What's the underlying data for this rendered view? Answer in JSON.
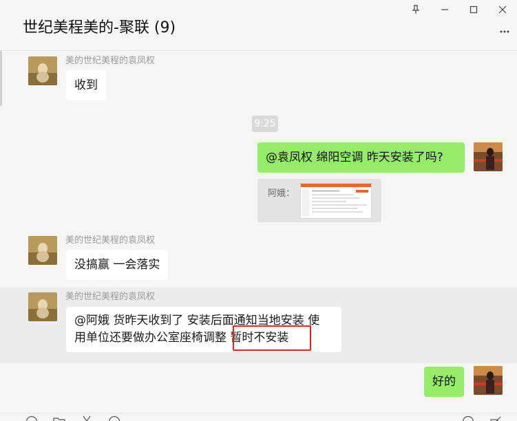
{
  "header": {
    "title": "世纪美程美的-聚联 (9)",
    "controls": {
      "pin_icon": "pin-icon",
      "minimize_icon": "minimize-icon",
      "maximize_icon": "maximize-icon",
      "close_icon": "close-icon",
      "more_icon": "more-icon"
    }
  },
  "messages": [
    {
      "type": "in",
      "sender": "美的世纪美程的袁凤权",
      "text": "收到"
    },
    {
      "type": "time",
      "text": "9:25"
    },
    {
      "type": "out",
      "text": "@袁凤权 绵阳空调 昨天安装了吗?"
    },
    {
      "type": "quote",
      "label": "阿娥："
    },
    {
      "type": "in",
      "sender": "美的世纪美程的袁凤权",
      "text": "没搞赢 一会落实"
    },
    {
      "type": "in",
      "sender": "美的世纪美程的袁凤权",
      "line1": "@阿娥 货昨天收到了  安装后面通知当地安装  使",
      "line2": "用单位还要做办公室座椅调整 ",
      "highlight": "暂时不安装"
    },
    {
      "type": "out",
      "text": "好的"
    }
  ],
  "colors": {
    "out_bubble": "#95ec69",
    "in_bubble": "#ffffff",
    "chat_bg": "#f5f5f5",
    "highlight_box": "#e0241c"
  }
}
